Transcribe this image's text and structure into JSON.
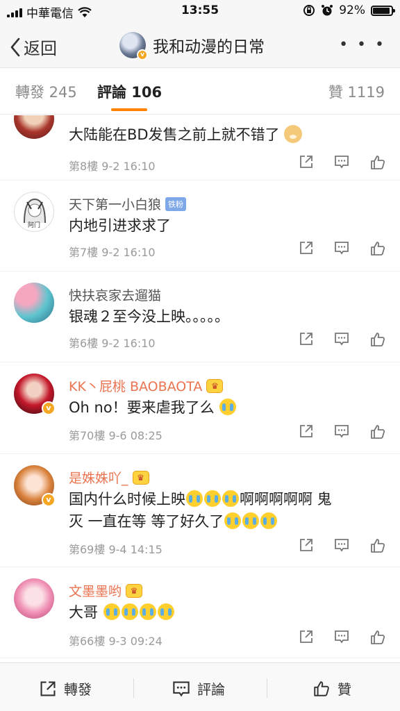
{
  "status_bar": {
    "carrier": "中華電信",
    "time": "13:55",
    "battery": "92%",
    "battery_level": 0.92
  },
  "nav": {
    "back_label": "返回",
    "title": "我和动漫的日常",
    "more": "• • •"
  },
  "tabs": {
    "repost": "轉發 245",
    "comments": "評論 106",
    "likes": "贊 1119"
  },
  "comments": [
    {
      "name": "",
      "text": "大陆能在BD发售之前上就不错了",
      "floor": "第8樓",
      "time": "9-2 16:10",
      "emoji": "doge"
    },
    {
      "name": "天下第一小白狼",
      "badge": "铁粉",
      "avatar_caption": "阿门",
      "text": "内地引进求求了",
      "floor": "第7樓",
      "time": "9-2 16:10"
    },
    {
      "name": "快扶哀家去遛猫",
      "text": "银魂２至今没上映。。。。。",
      "floor": "第6樓",
      "time": "9-2 16:10"
    },
    {
      "name": "KK丶屁桃 BAOBAOTA",
      "vip": true,
      "verified": true,
      "text": "Oh no！要来虐我了么",
      "floor": "第70樓",
      "time": "9-6 08:25",
      "emoji_count": 1
    },
    {
      "name": "是姝姝吖_",
      "vip": true,
      "verified": true,
      "text_line1_a": "国内什么时候上映",
      "text_line1_b": "啊啊啊啊啊 鬼",
      "text_line2_a": "灭 一直在等 等了好久了",
      "floor": "第69樓",
      "time": "9-4 14:15"
    },
    {
      "name": "文墨墨哟",
      "vip": true,
      "text": "大哥",
      "floor": "第66樓",
      "time": "9-3 09:24",
      "emoji_count": 4
    }
  ],
  "bottom_bar": {
    "repost": "轉發",
    "comment": "評論",
    "like": "贊"
  },
  "colors": {
    "accent": "#ff8200",
    "vip_name": "#eb7350",
    "verified": "#f5a623"
  }
}
